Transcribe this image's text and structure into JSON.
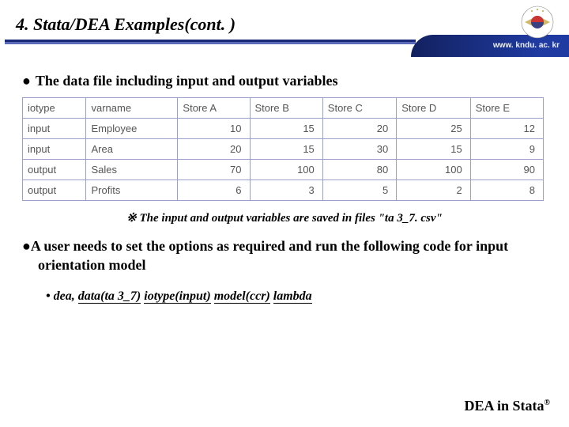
{
  "header": {
    "title": "4. Stata/DEA Examples(cont. )",
    "url": "www. kndu. ac. kr"
  },
  "bullet1": "The data file including input and output variables",
  "table": {
    "headers": [
      "iotype",
      "varname",
      "Store A",
      "Store B",
      "Store C",
      "Store D",
      "Store E"
    ],
    "rows": [
      {
        "c0": "input",
        "c1": "Employee",
        "c2": "10",
        "c3": "15",
        "c4": "20",
        "c5": "25",
        "c6": "12"
      },
      {
        "c0": "input",
        "c1": "Area",
        "c2": "20",
        "c3": "15",
        "c4": "30",
        "c5": "15",
        "c6": "9"
      },
      {
        "c0": "output",
        "c1": "Sales",
        "c2": "70",
        "c3": "100",
        "c4": "80",
        "c5": "100",
        "c6": "90"
      },
      {
        "c0": "output",
        "c1": "Profits",
        "c2": "6",
        "c3": "3",
        "c4": "5",
        "c5": "2",
        "c6": "8"
      }
    ]
  },
  "note": "※ The input and output variables are saved in files \"ta 3_7. csv\"",
  "bullet2": "A user needs to set the options as required and run the following code for input orientation model",
  "code": {
    "prefix": "• dea, ",
    "p1": "data(ta 3_7)",
    "sp1": " ",
    "p2": "iotype(input)",
    "sp2": " ",
    "p3": "model(ccr)",
    "sp3": " ",
    "p4": "lambda"
  },
  "footer": {
    "text": "DEA in Stata",
    "trademark": "®"
  },
  "chart_data": {
    "type": "table",
    "title": "The data file including input and output variables",
    "columns": [
      "iotype",
      "varname",
      "Store A",
      "Store B",
      "Store C",
      "Store D",
      "Store E"
    ],
    "rows": [
      [
        "input",
        "Employee",
        10,
        15,
        20,
        25,
        12
      ],
      [
        "input",
        "Area",
        20,
        15,
        30,
        15,
        9
      ],
      [
        "output",
        "Sales",
        70,
        100,
        80,
        100,
        90
      ],
      [
        "output",
        "Profits",
        6,
        3,
        5,
        2,
        8
      ]
    ]
  }
}
